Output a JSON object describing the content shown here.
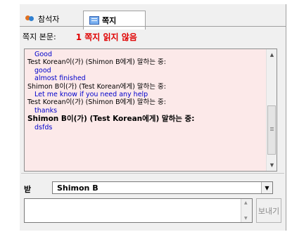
{
  "tabs": [
    {
      "label": "참석자",
      "icon": "participants-icon"
    },
    {
      "label": "쪽지",
      "icon": "note-icon",
      "active": true
    }
  ],
  "body_label": "쪽지 본문:",
  "unread_notice": "1 쪽지 읽지 않음",
  "unread_color": "#e00000",
  "messages": [
    {
      "text": "Good"
    },
    {
      "speaker": "Test Korean이(가) (Shimon B에게) 말하는 중:"
    },
    {
      "text": "good"
    },
    {
      "text": "almost finished"
    },
    {
      "speaker": "Shimon B이(가) (Test Korean에게) 말하는 중:"
    },
    {
      "text": "Let me know if you need any help"
    },
    {
      "speaker": "Test Korean이(가) (Shimon B에게) 말하는 중:"
    },
    {
      "text": "thanks"
    },
    {
      "speaker": "Shimon B이(가) (Test Korean에게) 말하는 중:",
      "bold": true
    },
    {
      "text": "dsfds"
    }
  ],
  "recipient": {
    "label": "받",
    "selected": "Shimon B"
  },
  "compose": {
    "value": "",
    "send_label": "보내기"
  }
}
